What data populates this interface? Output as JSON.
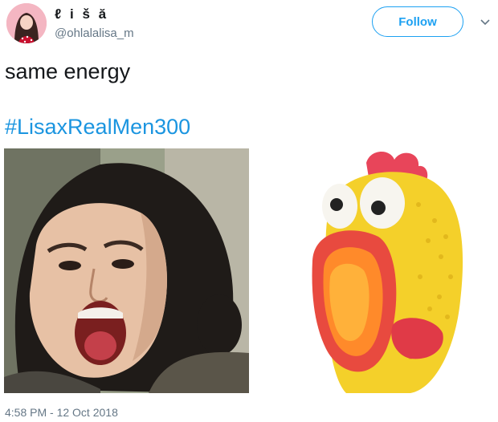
{
  "tweet": {
    "display_name": "ℓ i š ă",
    "handle": "@ohlalalisa_m",
    "follow_label": "Follow",
    "text": "same energy",
    "hashtag": "#LisaxRealMen300",
    "timestamp": "4:58 PM - 12 Oct 2018",
    "media": [
      {
        "icon": "screaming-woman-photo"
      },
      {
        "icon": "rubber-chicken-photo"
      }
    ]
  },
  "colors": {
    "accent": "#1da1f2",
    "hashtag": "#1b95e0",
    "secondary_text": "#657786"
  }
}
